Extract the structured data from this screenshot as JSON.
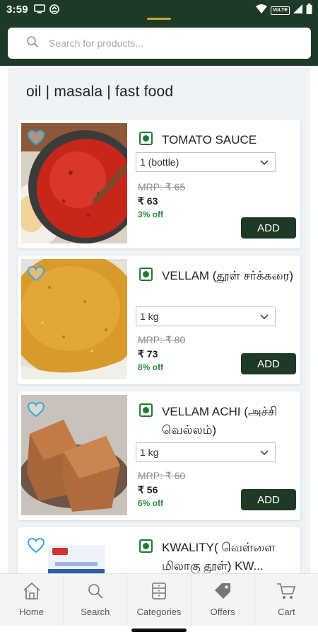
{
  "status_bar": {
    "time": "3:59",
    "network_label": "VoLTE"
  },
  "search": {
    "placeholder": "Search for products..."
  },
  "section": {
    "title": "oil | masala | fast food"
  },
  "products": [
    {
      "name": "TOMATO SAUCE",
      "variant": "1 (bottle)",
      "mrp": "MRP: ₹ 65",
      "price": "₹ 63",
      "discount": "3% off",
      "add_label": "ADD",
      "image": "tomato-sauce-in-pot"
    },
    {
      "name": "VELLAM (தூள் சர்க்கரை)",
      "variant": "1 kg",
      "mrp": "MRP: ₹ 80",
      "price": "₹ 73",
      "discount": "8% off",
      "add_label": "ADD",
      "image": "powdered-jaggery"
    },
    {
      "name": "VELLAM ACHI (அச்சி வெல்லம்)",
      "variant": "1 kg",
      "mrp": "MRP: ₹ 60",
      "price": "₹ 56",
      "discount": "6% off",
      "add_label": "ADD",
      "image": "jaggery-blocks"
    },
    {
      "name": "KWALITY( வெள்ளை மிலாகு தூள்) KW...",
      "image": "kwality-pepper-pack"
    }
  ],
  "bottom_nav": [
    {
      "label": "Home",
      "icon": "home-icon"
    },
    {
      "label": "Search",
      "icon": "search-icon"
    },
    {
      "label": "Categories",
      "icon": "categories-icon"
    },
    {
      "label": "Offers",
      "icon": "offers-tag-icon"
    },
    {
      "label": "Cart",
      "icon": "cart-icon"
    }
  ],
  "colors": {
    "brand_dark_green": "#1e3a26",
    "accent_gold": "#c9a437",
    "discount_green": "#2a8c3a",
    "favorite_blue": "#3aa6de",
    "veg_green": "#1f7a33"
  }
}
